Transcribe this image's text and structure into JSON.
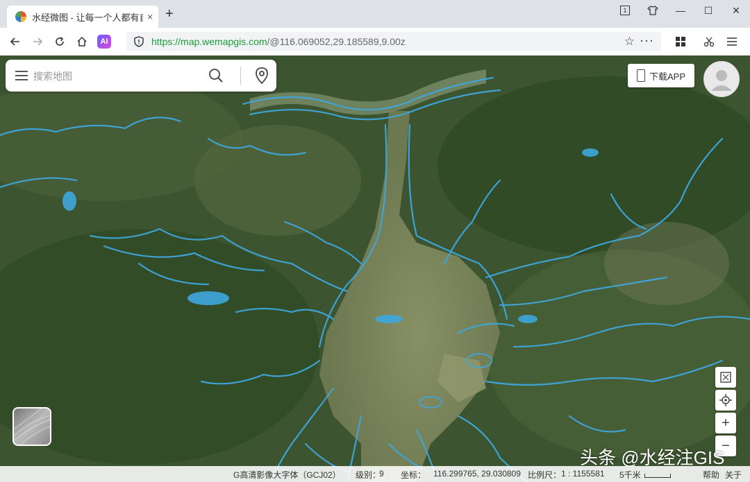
{
  "browser": {
    "tab_title": "水经微图 - 让每一个人都有自",
    "tab_close": "×",
    "new_tab": "+",
    "url_scheme": "https://",
    "url_host": "map.wemapgis.com",
    "url_path": "/@116.069052,29.185589,9.00z",
    "ai_label": "AI",
    "window": {
      "minimize": "—",
      "maximize": "☐",
      "close": "✕",
      "tab_count": "1"
    }
  },
  "search": {
    "placeholder": "搜索地图"
  },
  "download": {
    "label": "下载APP"
  },
  "map_controls": {
    "zoom_in": "+",
    "zoom_out": "−"
  },
  "statusbar": {
    "layer_name": "G高清影像大字体（GCJ02）",
    "level_label": "级别：",
    "level_value": "9",
    "coord_label": "坐标：",
    "coord_value": "116.299765, 29.030809",
    "scale_label": "比例尺：",
    "scale_value": "1 : 1155581",
    "scale_distance": "5千米",
    "help": "帮助",
    "about": "关于"
  },
  "watermark": "头条 @水经注GIS",
  "colors": {
    "water_overlay": "#3ea7dd",
    "url_green": "#1a9c3a"
  }
}
